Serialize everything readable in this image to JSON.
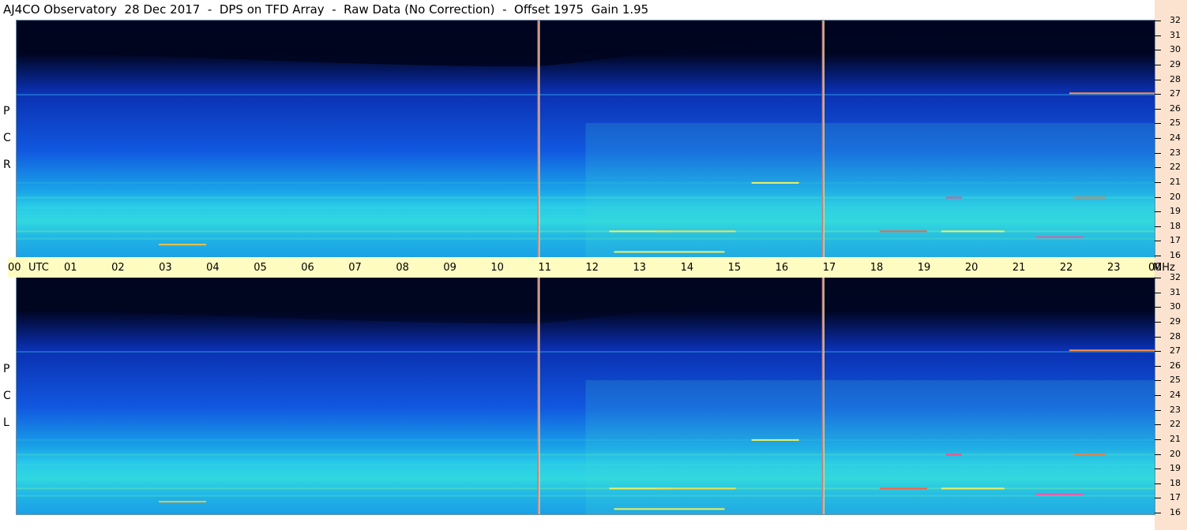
{
  "title": "AJ4CO Observatory  28 Dec 2017  -  DPS on TFD Array  -  Raw Data (No Correction)  -  Offset 1975  Gain 1.95",
  "chart_data": {
    "type": "heatmap",
    "panels": [
      {
        "name": "R C P",
        "side_letters": [
          "P",
          "C",
          "R"
        ]
      },
      {
        "name": "L C P",
        "side_letters": [
          "P",
          "C",
          "L"
        ]
      }
    ],
    "x_axis": {
      "unit_label": "UTC",
      "ticks": [
        "00",
        "01",
        "02",
        "03",
        "04",
        "05",
        "06",
        "07",
        "08",
        "09",
        "10",
        "11",
        "12",
        "13",
        "14",
        "15",
        "16",
        "17",
        "18",
        "19",
        "20",
        "21",
        "22",
        "23",
        "00"
      ],
      "range_hours": [
        0,
        24
      ]
    },
    "y_axis": {
      "unit_label": "MHz",
      "ticks": [
        "32",
        "31",
        "30",
        "29",
        "28",
        "27",
        "26",
        "25",
        "24",
        "23",
        "22",
        "21",
        "20",
        "19",
        "18",
        "17",
        "16"
      ],
      "range_mhz": [
        16,
        32
      ]
    },
    "markers_utc_hours": [
      11,
      17
    ],
    "colors": {
      "background_low": "#000522",
      "mid": "#1a6be0",
      "high": "#3ae6e0",
      "peak": "#ff3030",
      "marker": "#c08080",
      "timebar": "#fffcc2",
      "rightstrip": "#fbe3cf"
    }
  }
}
